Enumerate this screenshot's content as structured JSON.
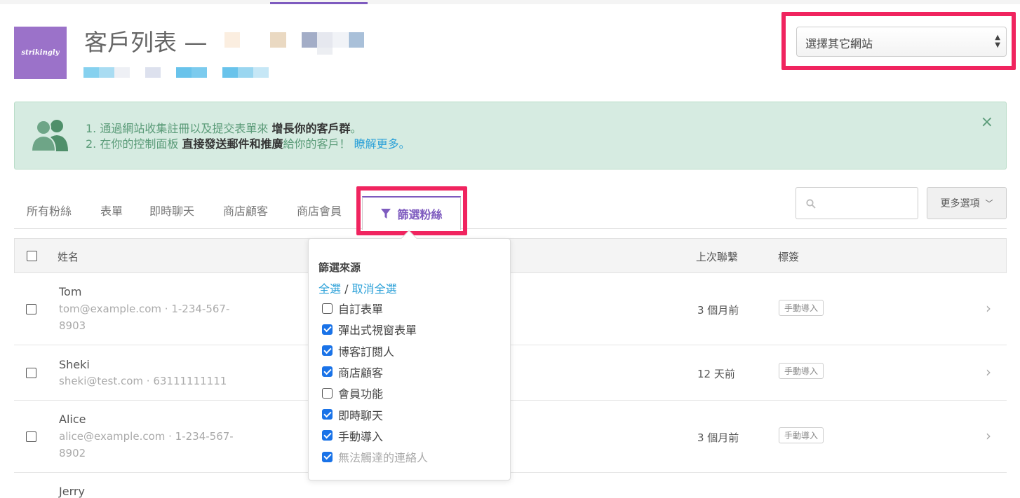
{
  "header": {
    "logo_text": "strikingly",
    "title": "客戶列表 —"
  },
  "site_select": {
    "value": "選擇其它網站"
  },
  "banner": {
    "line1_prefix": "1. 通過網站收集註冊以及提交表單來 ",
    "line1_bold": "增長你的客戶群",
    "line1_suffix": "。",
    "line2_prefix": "2. 在你的控制面板 ",
    "line2_bold": "直接發送郵件和推廣",
    "line2_mid": "給你的客戶！ ",
    "line2_link": "瞭解更多。",
    "close": "×"
  },
  "tabs": [
    "所有粉絲",
    "表單",
    "即時聊天",
    "商店顧客",
    "商店會員"
  ],
  "filter_tab": {
    "label": "篩選粉絲"
  },
  "search": {
    "placeholder": ""
  },
  "more_button": {
    "label": "更多選項"
  },
  "table": {
    "headers": {
      "name": "姓名",
      "last_contact": "上次聯繫",
      "tags": "標簽"
    },
    "rows": [
      {
        "name": "Tom",
        "contact": "tom@example.com · 1-234-567-8903",
        "last_contact": "3 個月前",
        "tag": "手動導入"
      },
      {
        "name": "Sheki",
        "contact": "sheki@test.com · 63111111111",
        "last_contact": "12 天前",
        "tag": "手動導入"
      },
      {
        "name": "Alice",
        "contact": "alice@example.com · 1-234-567-8902",
        "last_contact": "3 個月前",
        "tag": "手動導入"
      },
      {
        "name": "Jerry",
        "contact": "",
        "last_contact": "",
        "tag": ""
      }
    ]
  },
  "filter_popover": {
    "title": "篩選來源",
    "select_all": "全選",
    "separator": "/",
    "deselect_all": "取消全選",
    "options": [
      {
        "label": "自訂表單",
        "checked": false,
        "disabled": false
      },
      {
        "label": "彈出式視窗表單",
        "checked": true,
        "disabled": false
      },
      {
        "label": "博客訂閱人",
        "checked": true,
        "disabled": false
      },
      {
        "label": "商店顧客",
        "checked": true,
        "disabled": false
      },
      {
        "label": "會員功能",
        "checked": false,
        "disabled": false
      },
      {
        "label": "即時聊天",
        "checked": true,
        "disabled": false
      },
      {
        "label": "手動導入",
        "checked": true,
        "disabled": false
      },
      {
        "label": "無法觸達的連絡人",
        "checked": true,
        "disabled": true
      }
    ]
  },
  "colors": {
    "accent": "#7e5bbf",
    "highlight": "#f0245f",
    "link": "#2aa0d8",
    "banner_bg": "#d6ebe1"
  }
}
